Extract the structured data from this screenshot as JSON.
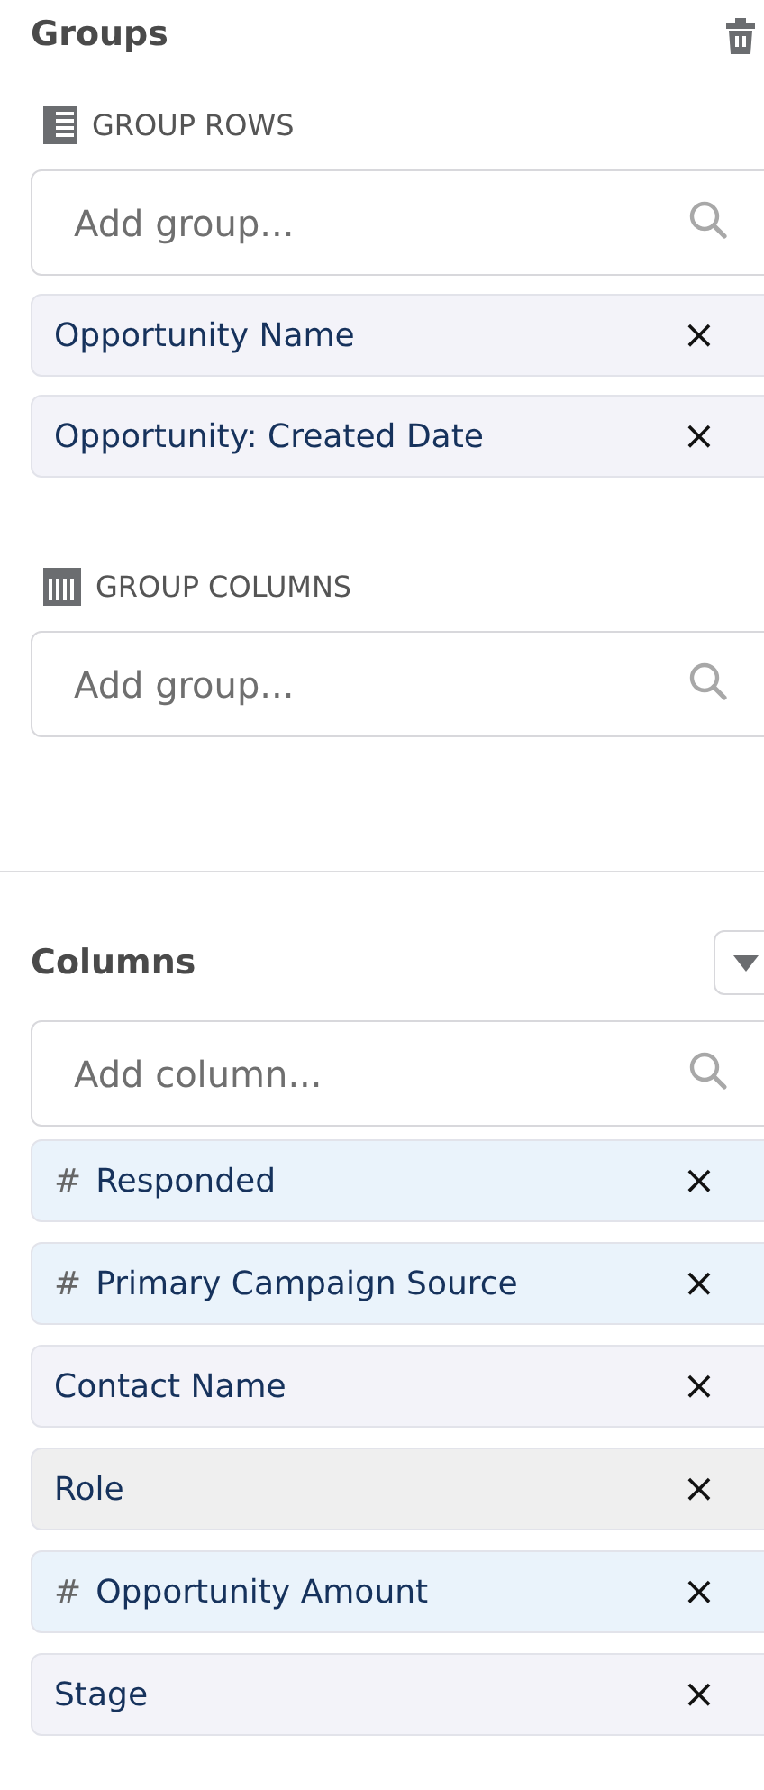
{
  "groups": {
    "title": "Groups",
    "sections": [
      {
        "kind": "rows",
        "label": "GROUP ROWS",
        "placeholder": "Add group...",
        "items": [
          {
            "kind": "text",
            "label": "Opportunity Name",
            "remove": "×"
          },
          {
            "kind": "text",
            "label": "Opportunity: Created Date",
            "remove": "×"
          }
        ]
      },
      {
        "kind": "columns",
        "label": "GROUP COLUMNS",
        "placeholder": "Add group..."
      }
    ]
  },
  "columns": {
    "title": "Columns",
    "placeholder": "Add column...",
    "items": [
      {
        "kind": "number",
        "symbol": "#",
        "label": "Responded",
        "remove": "×"
      },
      {
        "kind": "number",
        "symbol": "#",
        "label": "Primary Campaign Source",
        "remove": "×"
      },
      {
        "kind": "text",
        "label": "Contact Name",
        "remove": "×"
      },
      {
        "kind": "other",
        "label": "Role",
        "remove": "×"
      },
      {
        "kind": "number",
        "symbol": "#",
        "label": "Opportunity Amount",
        "remove": "×"
      },
      {
        "kind": "text",
        "label": "Stage",
        "remove": "×"
      }
    ]
  }
}
